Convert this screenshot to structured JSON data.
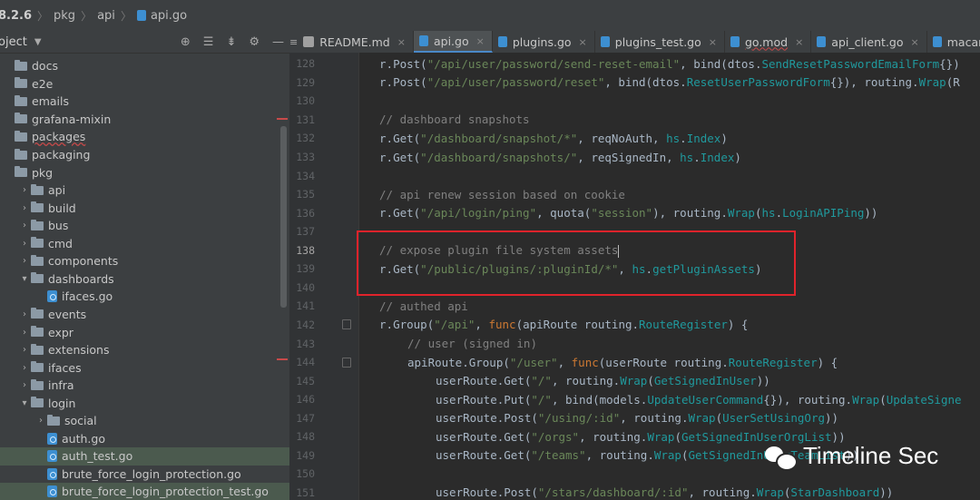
{
  "breadcrumb": [
    "8.2.6",
    "pkg",
    "api",
    "api.go"
  ],
  "sidebar": {
    "title": "oject",
    "dropdown_icon": "chevron-down-icon",
    "tools": [
      "locate-icon",
      "collapse-icon",
      "expand-icon",
      "gear-icon",
      "minimize-icon"
    ],
    "items": [
      {
        "label": "docs",
        "type": "folder",
        "indent": 0,
        "arrow": ""
      },
      {
        "label": "e2e",
        "type": "folder",
        "indent": 0,
        "arrow": ""
      },
      {
        "label": "emails",
        "type": "folder",
        "indent": 0,
        "arrow": ""
      },
      {
        "label": "grafana-mixin",
        "type": "folder",
        "indent": 0,
        "arrow": ""
      },
      {
        "label": "packages",
        "type": "folder",
        "indent": 0,
        "arrow": ""
      },
      {
        "label": "packaging",
        "type": "folder",
        "indent": 0,
        "arrow": ""
      },
      {
        "label": "pkg",
        "type": "folder",
        "indent": 0,
        "arrow": ""
      },
      {
        "label": "api",
        "type": "folder",
        "indent": 1,
        "arrow": "›"
      },
      {
        "label": "build",
        "type": "folder",
        "indent": 1,
        "arrow": "›"
      },
      {
        "label": "bus",
        "type": "folder",
        "indent": 1,
        "arrow": "›"
      },
      {
        "label": "cmd",
        "type": "folder",
        "indent": 1,
        "arrow": "›"
      },
      {
        "label": "components",
        "type": "folder",
        "indent": 1,
        "arrow": "›"
      },
      {
        "label": "dashboards",
        "type": "folder",
        "indent": 1,
        "arrow": "⌄"
      },
      {
        "label": "ifaces.go",
        "type": "file",
        "indent": 2,
        "arrow": ""
      },
      {
        "label": "events",
        "type": "folder",
        "indent": 1,
        "arrow": "›"
      },
      {
        "label": "expr",
        "type": "folder",
        "indent": 1,
        "arrow": "›"
      },
      {
        "label": "extensions",
        "type": "folder",
        "indent": 1,
        "arrow": "›"
      },
      {
        "label": "ifaces",
        "type": "folder",
        "indent": 1,
        "arrow": "›"
      },
      {
        "label": "infra",
        "type": "folder",
        "indent": 1,
        "arrow": "›"
      },
      {
        "label": "login",
        "type": "folder",
        "indent": 1,
        "arrow": "⌄"
      },
      {
        "label": "social",
        "type": "folder",
        "indent": 2,
        "arrow": "›"
      },
      {
        "label": "auth.go",
        "type": "file",
        "indent": 2,
        "arrow": ""
      },
      {
        "label": "auth_test.go",
        "type": "file",
        "indent": 2,
        "arrow": "",
        "selected": true
      },
      {
        "label": "brute_force_login_protection.go",
        "type": "file",
        "indent": 2,
        "arrow": ""
      },
      {
        "label": "brute_force_login_protection_test.go",
        "type": "file",
        "indent": 2,
        "arrow": "",
        "selected": true
      }
    ]
  },
  "tabs": [
    {
      "label": "README.md",
      "icon": "md-file-icon",
      "active": false,
      "modified": false
    },
    {
      "label": "api.go",
      "icon": "go-file-icon",
      "active": true,
      "modified": false
    },
    {
      "label": "plugins.go",
      "icon": "go-file-icon",
      "active": false,
      "modified": false
    },
    {
      "label": "plugins_test.go",
      "icon": "go-file-icon",
      "active": false,
      "modified": false
    },
    {
      "label": "go.mod",
      "icon": "go-file-icon",
      "active": false,
      "modified": true
    },
    {
      "label": "api_client.go",
      "icon": "go-file-icon",
      "active": false,
      "modified": false
    },
    {
      "label": "macaron.go",
      "icon": "go-file-icon",
      "active": false,
      "modified": false
    }
  ],
  "code_lines": [
    {
      "n": "128",
      "indent": 0,
      "tokens": [
        [
          "id",
          "r."
        ],
        [
          "fn2",
          "Post"
        ],
        [
          "id",
          "("
        ],
        [
          "str",
          "\"/api/user/password/send-reset-email\""
        ],
        [
          "id",
          ", bind(dtos."
        ],
        [
          "ty",
          "SendResetPasswordEmailForm"
        ],
        [
          "id",
          "{})"
        ]
      ]
    },
    {
      "n": "129",
      "indent": 0,
      "tokens": [
        [
          "id",
          "r."
        ],
        [
          "fn2",
          "Post"
        ],
        [
          "id",
          "("
        ],
        [
          "str",
          "\"/api/user/password/reset\""
        ],
        [
          "id",
          ", bind(dtos."
        ],
        [
          "ty",
          "ResetUserPasswordForm"
        ],
        [
          "id",
          "{}), routing."
        ],
        [
          "ty",
          "Wrap"
        ],
        [
          "id",
          "(R"
        ]
      ]
    },
    {
      "n": "130",
      "indent": 0,
      "tokens": []
    },
    {
      "n": "131",
      "indent": 0,
      "tokens": [
        [
          "cm",
          "// dashboard snapshots"
        ]
      ]
    },
    {
      "n": "132",
      "indent": 0,
      "tokens": [
        [
          "id",
          "r."
        ],
        [
          "fn2",
          "Get"
        ],
        [
          "id",
          "("
        ],
        [
          "str",
          "\"/dashboard/snapshot/*\""
        ],
        [
          "id",
          ", reqNoAuth, "
        ],
        [
          "ty",
          "hs"
        ],
        [
          "id",
          "."
        ],
        [
          "ty",
          "Index"
        ],
        [
          "id",
          ")"
        ]
      ]
    },
    {
      "n": "133",
      "indent": 0,
      "tokens": [
        [
          "id",
          "r."
        ],
        [
          "fn2",
          "Get"
        ],
        [
          "id",
          "("
        ],
        [
          "str",
          "\"/dashboard/snapshots/\""
        ],
        [
          "id",
          ", reqSignedIn, "
        ],
        [
          "ty",
          "hs"
        ],
        [
          "id",
          "."
        ],
        [
          "ty",
          "Index"
        ],
        [
          "id",
          ")"
        ]
      ]
    },
    {
      "n": "134",
      "indent": 0,
      "tokens": []
    },
    {
      "n": "135",
      "indent": 0,
      "tokens": [
        [
          "cm",
          "// api renew session based on cookie"
        ]
      ]
    },
    {
      "n": "136",
      "indent": 0,
      "tokens": [
        [
          "id",
          "r."
        ],
        [
          "fn2",
          "Get"
        ],
        [
          "id",
          "("
        ],
        [
          "str",
          "\"/api/login/ping\""
        ],
        [
          "id",
          ", quota("
        ],
        [
          "str",
          "\"session\""
        ],
        [
          "id",
          "), routing."
        ],
        [
          "ty",
          "Wrap"
        ],
        [
          "id",
          "("
        ],
        [
          "ty",
          "hs"
        ],
        [
          "id",
          "."
        ],
        [
          "ty",
          "LoginAPIPing"
        ],
        [
          "id",
          "))"
        ]
      ]
    },
    {
      "n": "137",
      "indent": 0,
      "tokens": []
    },
    {
      "n": "138",
      "indent": 0,
      "tokens": [
        [
          "cm",
          "// expose plugin file system assets"
        ]
      ],
      "caret": true
    },
    {
      "n": "139",
      "indent": 0,
      "tokens": [
        [
          "id",
          "r."
        ],
        [
          "fn2",
          "Get"
        ],
        [
          "id",
          "("
        ],
        [
          "str",
          "\"/public/plugins/:pluginId/*\""
        ],
        [
          "id",
          ", "
        ],
        [
          "ty",
          "hs"
        ],
        [
          "id",
          "."
        ],
        [
          "ty",
          "getPluginAssets"
        ],
        [
          "id",
          ")"
        ]
      ]
    },
    {
      "n": "140",
      "indent": 0,
      "tokens": []
    },
    {
      "n": "141",
      "indent": 0,
      "tokens": [
        [
          "cm",
          "// authed api"
        ]
      ]
    },
    {
      "n": "142",
      "indent": 0,
      "tokens": [
        [
          "id",
          "r."
        ],
        [
          "fn2",
          "Group"
        ],
        [
          "id",
          "("
        ],
        [
          "str",
          "\"/api\""
        ],
        [
          "id",
          ", "
        ],
        [
          "kw",
          "func"
        ],
        [
          "id",
          "(apiRoute routing."
        ],
        [
          "ty",
          "RouteRegister"
        ],
        [
          "id",
          ") {"
        ]
      ],
      "fold": true
    },
    {
      "n": "143",
      "indent": 1,
      "tokens": [
        [
          "cm",
          "// user (signed in)"
        ]
      ]
    },
    {
      "n": "144",
      "indent": 1,
      "tokens": [
        [
          "id",
          "apiRoute."
        ],
        [
          "fn2",
          "Group"
        ],
        [
          "id",
          "("
        ],
        [
          "str",
          "\"/user\""
        ],
        [
          "id",
          ", "
        ],
        [
          "kw",
          "func"
        ],
        [
          "id",
          "(userRoute routing."
        ],
        [
          "ty",
          "RouteRegister"
        ],
        [
          "id",
          ") {"
        ]
      ],
      "fold": true
    },
    {
      "n": "145",
      "indent": 2,
      "tokens": [
        [
          "id",
          "userRoute."
        ],
        [
          "fn2",
          "Get"
        ],
        [
          "id",
          "("
        ],
        [
          "str",
          "\"/\""
        ],
        [
          "id",
          ", routing."
        ],
        [
          "ty",
          "Wrap"
        ],
        [
          "id",
          "("
        ],
        [
          "ty",
          "GetSignedInUser"
        ],
        [
          "id",
          "))"
        ]
      ]
    },
    {
      "n": "146",
      "indent": 2,
      "tokens": [
        [
          "id",
          "userRoute."
        ],
        [
          "fn2",
          "Put"
        ],
        [
          "id",
          "("
        ],
        [
          "str",
          "\"/\""
        ],
        [
          "id",
          ", bind(models."
        ],
        [
          "ty",
          "UpdateUserCommand"
        ],
        [
          "id",
          "{}), routing."
        ],
        [
          "ty",
          "Wrap"
        ],
        [
          "id",
          "("
        ],
        [
          "ty",
          "UpdateSigne"
        ]
      ]
    },
    {
      "n": "147",
      "indent": 2,
      "tokens": [
        [
          "id",
          "userRoute."
        ],
        [
          "fn2",
          "Post"
        ],
        [
          "id",
          "("
        ],
        [
          "str",
          "\"/using/:id\""
        ],
        [
          "id",
          ", routing."
        ],
        [
          "ty",
          "Wrap"
        ],
        [
          "id",
          "("
        ],
        [
          "ty",
          "UserSetUsingOrg"
        ],
        [
          "id",
          "))"
        ]
      ]
    },
    {
      "n": "148",
      "indent": 2,
      "tokens": [
        [
          "id",
          "userRoute."
        ],
        [
          "fn2",
          "Get"
        ],
        [
          "id",
          "("
        ],
        [
          "str",
          "\"/orgs\""
        ],
        [
          "id",
          ", routing."
        ],
        [
          "ty",
          "Wrap"
        ],
        [
          "id",
          "("
        ],
        [
          "ty",
          "GetSignedInUserOrgList"
        ],
        [
          "id",
          "))"
        ]
      ]
    },
    {
      "n": "149",
      "indent": 2,
      "tokens": [
        [
          "id",
          "userRoute."
        ],
        [
          "fn2",
          "Get"
        ],
        [
          "id",
          "("
        ],
        [
          "str",
          "\"/teams\""
        ],
        [
          "id",
          ", routing."
        ],
        [
          "ty",
          "Wrap"
        ],
        [
          "id",
          "("
        ],
        [
          "ty",
          "GetSignedInUserTeamList"
        ],
        [
          "id",
          "))"
        ]
      ]
    },
    {
      "n": "150",
      "indent": 0,
      "tokens": []
    },
    {
      "n": "151",
      "indent": 2,
      "tokens": [
        [
          "id",
          "userRoute."
        ],
        [
          "fn2",
          "Post"
        ],
        [
          "id",
          "("
        ],
        [
          "str",
          "\"/stars/dashboard/:id\""
        ],
        [
          "id",
          ", routing."
        ],
        [
          "ty",
          "Wrap"
        ],
        [
          "id",
          "("
        ],
        [
          "ty",
          "StarDashboard"
        ],
        [
          "id",
          "))"
        ]
      ]
    }
  ],
  "colors": {
    "accent": "#4a88c7",
    "highlight_box": "#e0232b",
    "string": "#6a8759",
    "comment": "#808080",
    "type": "#20999d"
  },
  "watermark": {
    "text": "Timeline Sec",
    "icon": "wechat-logo-icon"
  }
}
